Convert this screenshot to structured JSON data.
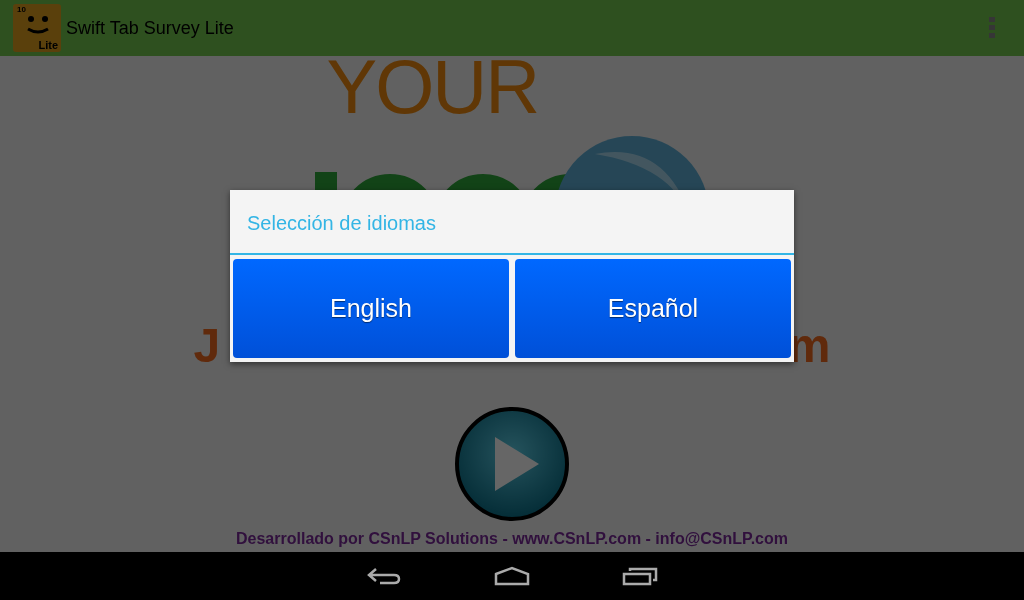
{
  "app_bar": {
    "icon_scale_label": "10",
    "icon_badge": "Lite",
    "title": "Swift Tab Survey Lite"
  },
  "logo": {
    "top": "YOUR"
  },
  "headline": {
    "left_visible": "J",
    "right_visible": "m"
  },
  "footer": "Desarrollado por CSnLP Solutions - www.CSnLP.com - info@CSnLP.com",
  "dialog": {
    "title": "Selección de idiomas",
    "buttons": [
      "English",
      "Español"
    ]
  }
}
